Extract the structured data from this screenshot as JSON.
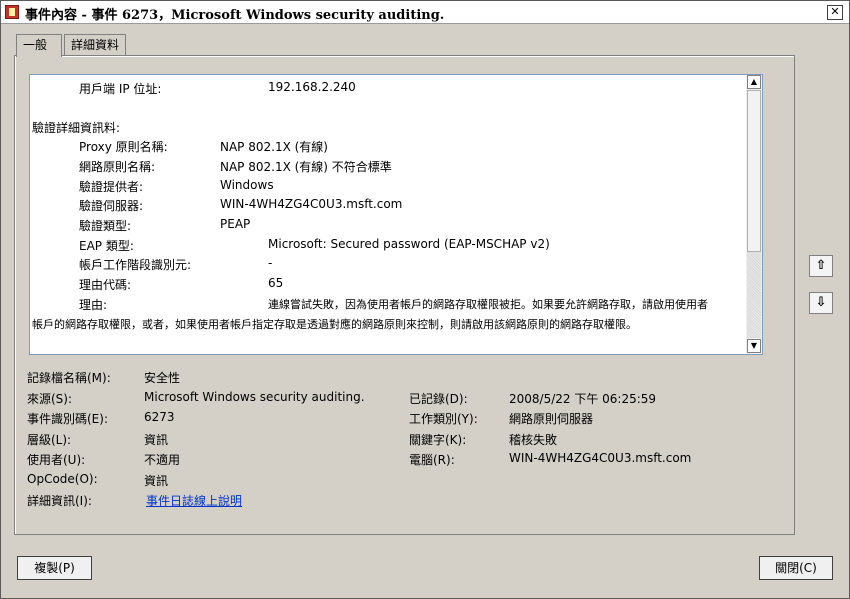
{
  "window": {
    "title": "事件內容 - 事件 6273，Microsoft Windows security auditing.",
    "close_glyph": "✕"
  },
  "tabs": [
    {
      "label": "一般"
    },
    {
      "label": "詳細資料"
    }
  ],
  "details": {
    "client_ip_label": "用戶端 IP 位址:",
    "client_ip_value": "192.168.2.240",
    "auth_section": "驗證詳細資訊料:",
    "proxy_policy_label": "Proxy 原則名稱:",
    "proxy_policy_value": "NAP 802.1X (有線)",
    "network_policy_label": "網路原則名稱:",
    "network_policy_value": "NAP 802.1X (有線) 不符合標準",
    "auth_provider_label": "驗證提供者:",
    "auth_provider_value": "Windows",
    "auth_server_label": "驗證伺服器:",
    "auth_server_value": "WIN-4WH4ZG4C0U3.msft.com",
    "auth_type_label": "驗證類型:",
    "auth_type_value": "PEAP",
    "eap_type_label": "EAP 類型:",
    "eap_type_value": "Microsoft: Secured password (EAP-MSCHAP v2)",
    "account_session_label": "帳戶工作階段識別元:",
    "account_session_value": "-",
    "reason_code_label": "理由代碼:",
    "reason_code_value": "65",
    "reason_label": "理由:",
    "reason_value_1": "連線嘗試失敗，因為使用者帳戶的網路存取權限被拒。如果要允許網路存取，請啟用使用者",
    "reason_value_2": "帳戶的網路存取權限，或者，如果使用者帳戶指定存取是透過對應的網路原則來控制，則請啟用該網路原則的網路存取權限。"
  },
  "scrollbar": {
    "up_glyph": "▲",
    "down_glyph": "▼"
  },
  "fields": {
    "log_name_label": "記錄檔名稱(M):",
    "log_name_value": "安全性",
    "source_label": "來源(S):",
    "source_value": "Microsoft Windows security auditing.",
    "logged_label": "已記錄(D):",
    "logged_value": "2008/5/22 下午 06:25:59",
    "event_id_label": "事件識別碼(E):",
    "event_id_value": "6273",
    "task_category_label": "工作類別(Y):",
    "task_category_value": "網路原則伺服器",
    "level_label": "層級(L):",
    "level_value": "資訊",
    "keywords_label": "關鍵字(K):",
    "keywords_value": "稽核失敗",
    "user_label": "使用者(U):",
    "user_value": "不適用",
    "computer_label": "電腦(R):",
    "computer_value": "WIN-4WH4ZG4C0U3.msft.com",
    "opcode_label": "OpCode(O):",
    "opcode_value": "資訊",
    "more_info_label": "詳細資訊(I):",
    "more_info_link": "事件日誌線上說明"
  },
  "side_buttons": {
    "up_glyph": "⇧",
    "down_glyph": "⇩"
  },
  "buttons": {
    "copy": "複製(P)",
    "close": "關閉(C)"
  }
}
